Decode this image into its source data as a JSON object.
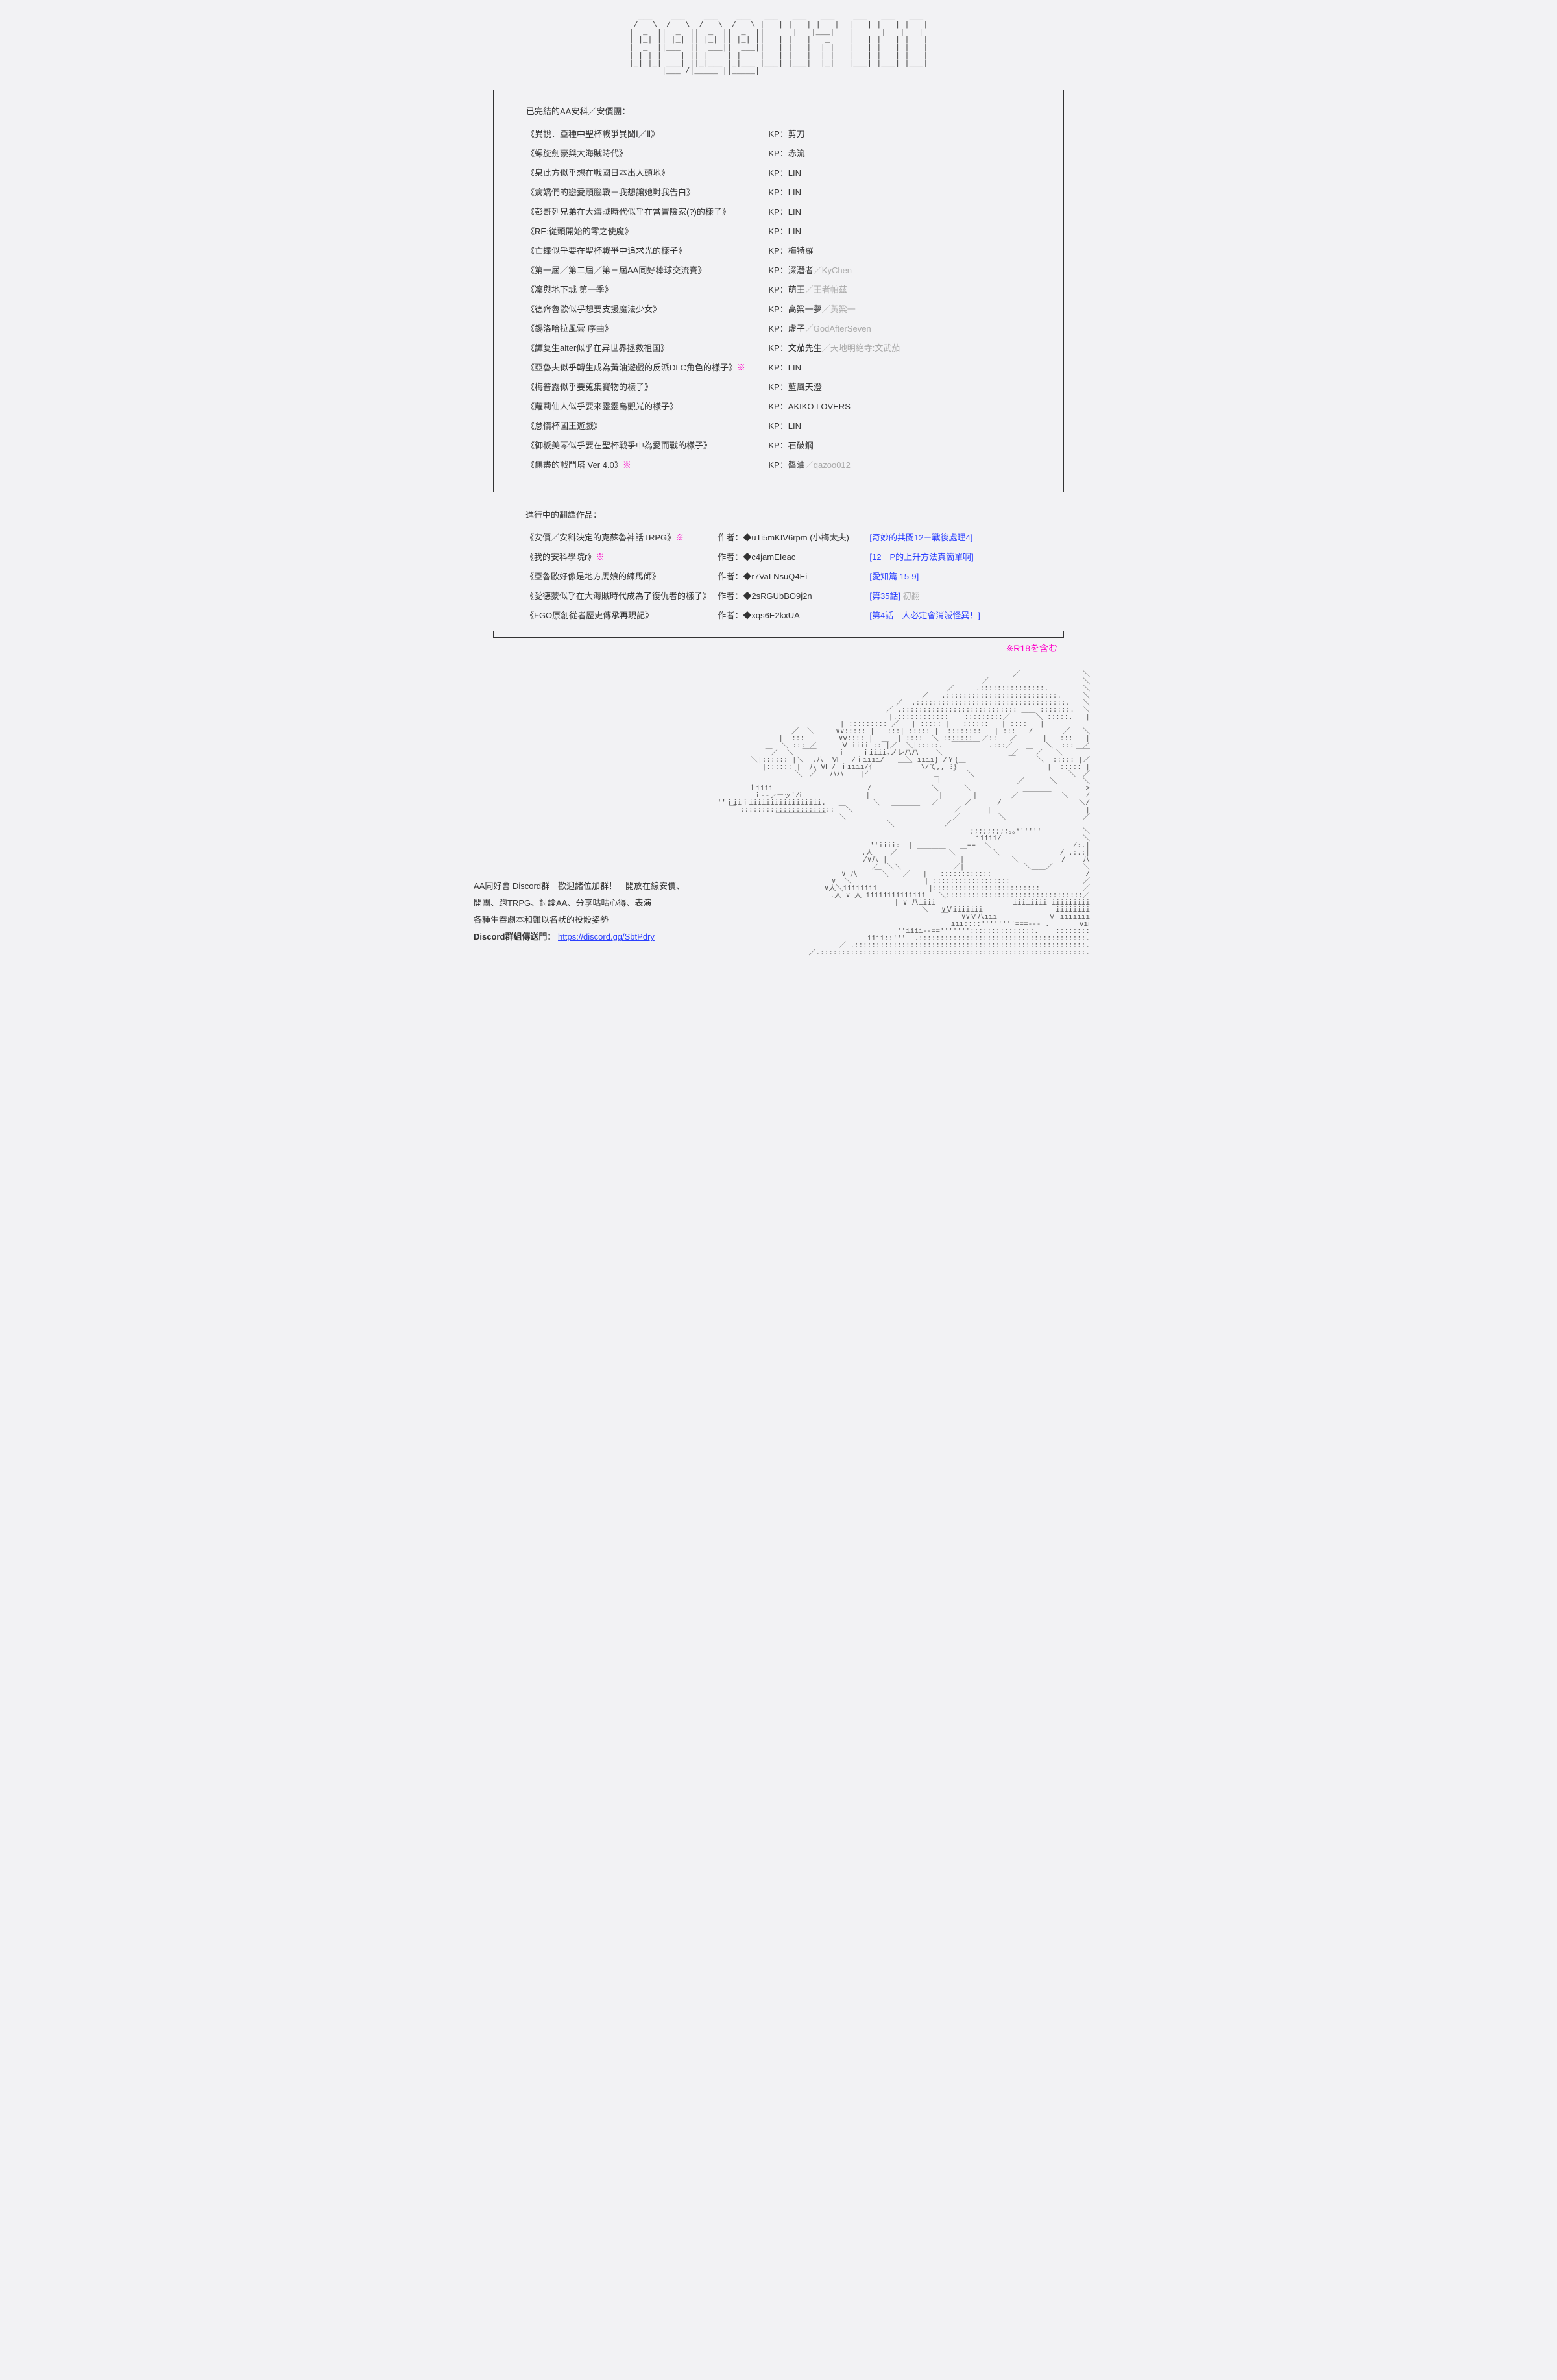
{
  "section1_heading": "已完結的AA安科／安價團：",
  "completed": [
    {
      "title": "《異說．亞種中聖杯戰爭異聞Ⅰ／Ⅱ》",
      "r18": false,
      "kp": "KP：剪刀",
      "alias": ""
    },
    {
      "title": "《螺旋劍豪與大海賊時代》",
      "r18": false,
      "kp": "KP：赤流",
      "alias": ""
    },
    {
      "title": "《泉此方似乎想在戰國日本出人頭地》",
      "r18": false,
      "kp": "KP：LIN",
      "alias": ""
    },
    {
      "title": "《病嬌們的戀愛頭腦戰－我想讓她對我告白》",
      "r18": false,
      "kp": "KP：LIN",
      "alias": ""
    },
    {
      "title": "《彭哥列兄弟在大海賊時代似乎在當冒險家(?)的樣子》",
      "r18": false,
      "kp": "KP：LIN",
      "alias": ""
    },
    {
      "title": "《RE:從頭開始的零之使魔》",
      "r18": false,
      "kp": "KP：LIN",
      "alias": ""
    },
    {
      "title": "《亡蝶似乎要在聖杯戰爭中追求光的樣子》",
      "r18": false,
      "kp": "KP：梅特羅",
      "alias": ""
    },
    {
      "title": "《第一屆／第二屆／第三屆AA同好棒球交流賽》",
      "r18": false,
      "kp": "KP：深潛者",
      "alias": "／KyChen"
    },
    {
      "title": "《凜與地下城 第一季》",
      "r18": false,
      "kp": "KP：萌王",
      "alias": "／王者帕茲"
    },
    {
      "title": "《德齊魯歐似乎想要支援魔法少女》",
      "r18": false,
      "kp": "KP：高粱一夢",
      "alias": "／黃粱一"
    },
    {
      "title": "《錫洛哈拉風雲 序曲》",
      "r18": false,
      "kp": "KP：虛子",
      "alias": "／GodAfterSeven"
    },
    {
      "title": "《譚复生alter似乎在异世界拯救祖国》",
      "r18": false,
      "kp": "KP：文茄先生",
      "alias": "／天地明絶寺:文武茄"
    },
    {
      "title": "《亞魯夫似乎轉生成為黃油遊戲的反派DLC角色的樣子》※",
      "r18": true,
      "kp": "KP：LIN",
      "alias": ""
    },
    {
      "title": "《梅普露似乎要蒐集寶物的樣子》",
      "r18": false,
      "kp": "KP：藍風天澄",
      "alias": ""
    },
    {
      "title": "《蘿莉仙人似乎要來靈靈島觀光的樣子》",
      "r18": false,
      "kp": "KP：AKIKO LOVERS",
      "alias": ""
    },
    {
      "title": "《怠惰杯國王遊戲》",
      "r18": false,
      "kp": "KP：LIN",
      "alias": ""
    },
    {
      "title": "《御板美琴似乎要在聖杯戰爭中為愛而戰的樣子》",
      "r18": false,
      "kp": "KP：石破鋼",
      "alias": ""
    },
    {
      "title": "《無盡的戰鬥塔 Ver 4.0》※",
      "r18": true,
      "kp": "KP：醬油",
      "alias": "／qazoo012"
    }
  ],
  "section2_heading": "進行中的翻譯作品：",
  "translations": [
    {
      "title": "《安價／安科決定的克蘇魯神話TRPG》※",
      "r18": true,
      "author": "作者：◆uTi5mKIV6rpm (小梅太夫)",
      "link": "[奇妙的共闘12－戰後處理4]",
      "dim": ""
    },
    {
      "title": "《我的安科學院r》※",
      "r18": true,
      "author": "作者：◆c4jamEIeac",
      "link": "[12　P的上升方法真簡單啊]",
      "dim": ""
    },
    {
      "title": "《亞魯歐好像是地方馬娘的練馬師》",
      "r18": false,
      "author": "作者：◆r7VaLNsuQ4Ei",
      "link": "[愛知篇 15-9]",
      "dim": ""
    },
    {
      "title": "《愛德蒙似乎在大海賊時代成為了復仇者的樣子》",
      "r18": false,
      "author": "作者：◆2sRGUbBO9j2n",
      "link": "[第35話] ",
      "dim": "初翻"
    },
    {
      "title": "《FGO原創從者歷史傳承再現記》",
      "r18": false,
      "author": "作者：◆xqs6E2kxUA",
      "link": "[第4話　人必定會消滅怪異！]",
      "dim": ""
    }
  ],
  "r18_note": "※R18を含む",
  "discord": {
    "line1": "AA同好會 Discord群　歡迎諸位加群！　開放在線安價、",
    "line2": "開團、跑TRPG、討論AA、分享咕咕心得、表演",
    "line3": "各種生吞劇本和難以名狀的投骰姿勢",
    "label": "Discord群組傳送門：",
    "url": "https://discord.gg/SbtPdry"
  }
}
